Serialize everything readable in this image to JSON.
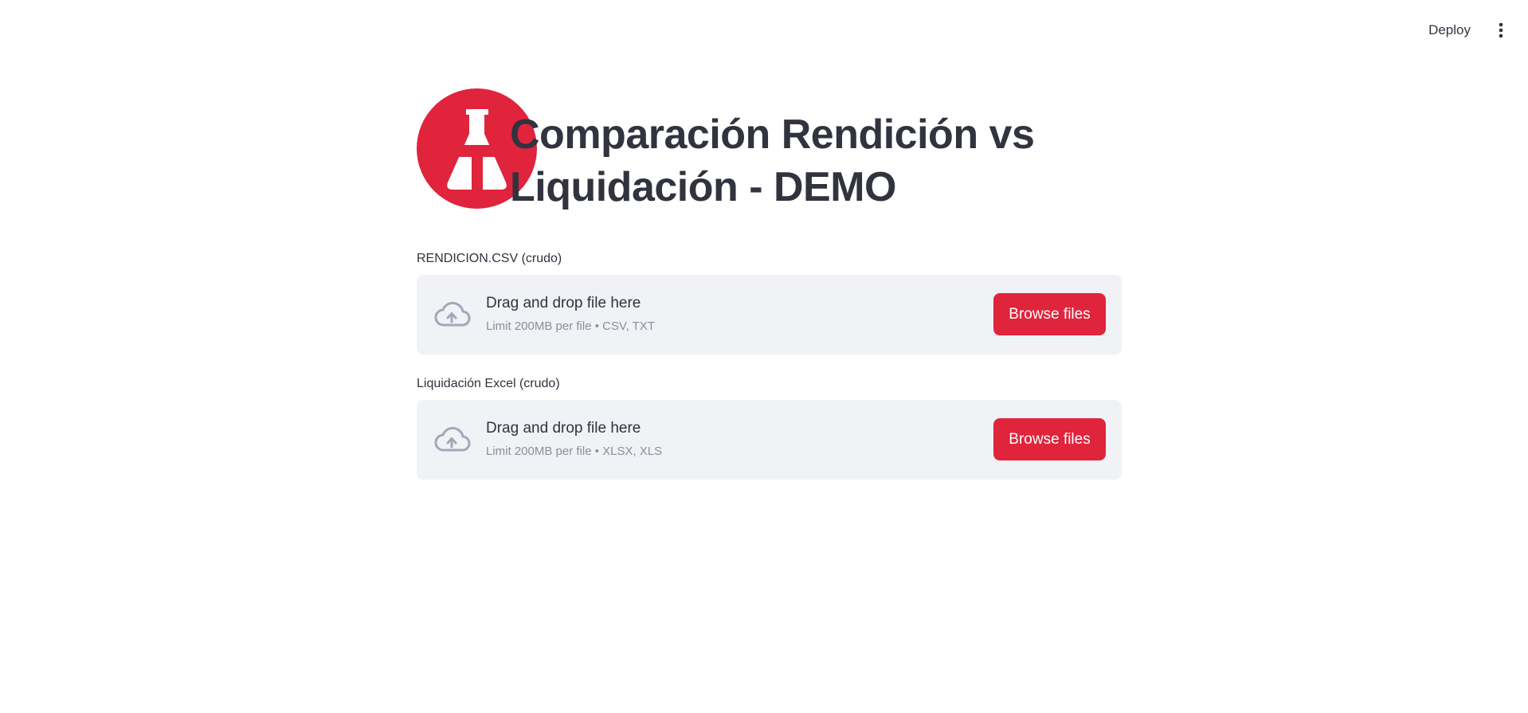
{
  "header": {
    "deploy_label": "Deploy",
    "menu_icon": "kebab-menu-icon"
  },
  "page": {
    "title": "Comparación Rendición vs Liquidación - DEMO",
    "logo_icon": "flask-logo",
    "accent_color": "#e0243c"
  },
  "uploaders": [
    {
      "label": "RENDICION.CSV (crudo)",
      "drop_title": "Drag and drop file here",
      "limit": "Limit 200MB per file • CSV, TXT",
      "button_label": "Browse files",
      "icon": "cloud-upload-icon"
    },
    {
      "label": "Liquidación Excel (crudo)",
      "drop_title": "Drag and drop file here",
      "limit": "Limit 200MB per file • XLSX, XLS",
      "button_label": "Browse files",
      "icon": "cloud-upload-icon"
    }
  ]
}
